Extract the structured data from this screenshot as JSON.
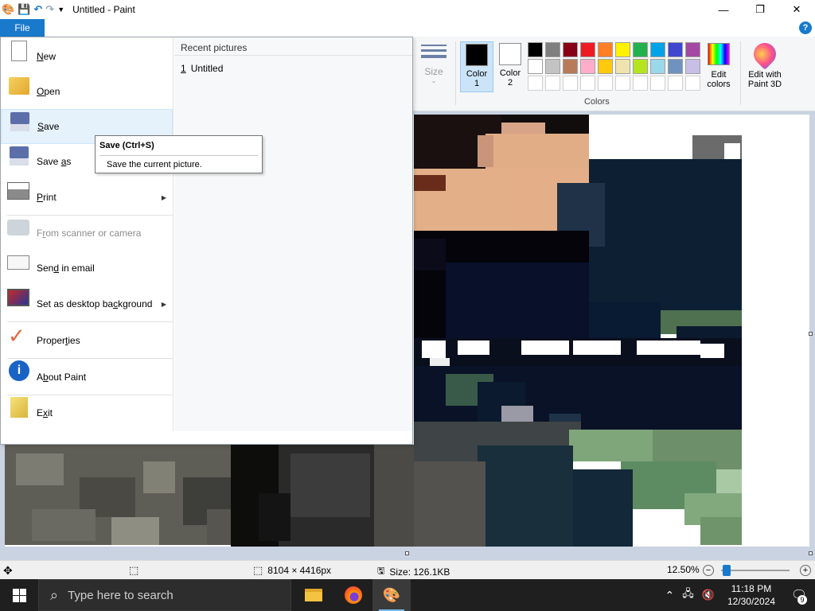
{
  "window": {
    "title": "Untitled - Paint",
    "controls": {
      "minimize": "—",
      "maximize": "❐",
      "close": "✕"
    }
  },
  "quick_access": {
    "icons": [
      "paint-app-icon",
      "save-icon",
      "undo-icon",
      "redo-icon",
      "customize-dropdown-icon"
    ]
  },
  "ribbon": {
    "file_tab_label": "File",
    "size_label": "Size",
    "color1_label": "Color\n1",
    "color1_value": "#000000",
    "color2_label": "Color\n2",
    "color2_value": "#ffffff",
    "colors_group_label": "Colors",
    "edit_colors_label": "Edit\ncolors",
    "edit_paint3d_label": "Edit with\nPaint 3D",
    "palette": [
      "#000000",
      "#7f7f7f",
      "#880015",
      "#ed1c24",
      "#ff7f27",
      "#fff200",
      "#22b14c",
      "#00a2e8",
      "#3f48cc",
      "#a349a4",
      "#ffffff",
      "#c3c3c3",
      "#b97a57",
      "#ffaec9",
      "#ffc90e",
      "#efe4b0",
      "#b5e61d",
      "#99d9ea",
      "#7092be",
      "#c8bfe7",
      "#ffffff",
      "#ffffff",
      "#ffffff",
      "#ffffff",
      "#ffffff",
      "#ffffff",
      "#ffffff",
      "#ffffff",
      "#ffffff",
      "#ffffff"
    ]
  },
  "file_menu": {
    "items": [
      {
        "label": "New",
        "icon": "new-file-icon",
        "mnemonic": 0
      },
      {
        "label": "Open",
        "icon": "open-folder-icon",
        "mnemonic": 0
      },
      {
        "label": "Save",
        "icon": "save-icon",
        "mnemonic": 0
      },
      {
        "label": "Save as",
        "icon": "save-as-icon",
        "mnemonic": 5
      },
      {
        "label": "Print",
        "icon": "printer-icon",
        "mnemonic": 0,
        "submenu": true
      },
      {
        "label": "From scanner or camera",
        "icon": "scanner-camera-icon",
        "mnemonic": 1,
        "disabled": true
      },
      {
        "label": "Send in email",
        "icon": "email-icon",
        "mnemonic": 3
      },
      {
        "label": "Set as desktop background",
        "icon": "desktop-background-icon",
        "mnemonic": 17,
        "submenu": true
      },
      {
        "label": "Properties",
        "icon": "checkmark-icon",
        "mnemonic": 6
      },
      {
        "label": "About Paint",
        "icon": "info-icon",
        "mnemonic": 1
      },
      {
        "label": "Exit",
        "icon": "exit-icon",
        "mnemonic": 1
      }
    ],
    "recent_title": "Recent pictures",
    "recent_items": [
      {
        "index": "1",
        "name": "Untitled"
      }
    ]
  },
  "tooltip": {
    "title": "Save (Ctrl+S)",
    "description": "Save the current picture."
  },
  "status_bar": {
    "dimensions": "8104 × 4416px",
    "size": "Size: 126.1KB",
    "zoom": "12.50%",
    "zoom_out": "−",
    "zoom_in": "+"
  },
  "taskbar": {
    "search_placeholder": "Type here to search",
    "time": "11:18 PM",
    "date": "12/30/2024",
    "notification_count": "9",
    "apps": [
      "file-explorer-icon",
      "firefox-icon",
      "paint-app-icon"
    ]
  },
  "canvas": {
    "pixels": [
      [
        520,
        144,
        110,
        70,
        "#1a1010"
      ],
      [
        630,
        144,
        120,
        30,
        "#120d0d"
      ],
      [
        630,
        154,
        55,
        15,
        "#d7a487"
      ],
      [
        610,
        168,
        130,
        60,
        "#e1ad86"
      ],
      [
        520,
        212,
        130,
        80,
        "#e3af88"
      ],
      [
        650,
        212,
        90,
        90,
        "#e3ae88"
      ],
      [
        520,
        220,
        40,
        20,
        "#6a2c1a"
      ],
      [
        600,
        170,
        20,
        40,
        "#c9957a"
      ],
      [
        740,
        144,
        130,
        60,
        "#ffffff"
      ],
      [
        870,
        170,
        62,
        50,
        "#6b6b6b"
      ],
      [
        910,
        180,
        20,
        30,
        "#ffffff"
      ],
      [
        740,
        200,
        192,
        190,
        "#0d1f33"
      ],
      [
        700,
        230,
        60,
        80,
        "#1f3247"
      ],
      [
        520,
        290,
        220,
        140,
        "#04040a"
      ],
      [
        520,
        300,
        40,
        40,
        "#0b0b1a"
      ],
      [
        560,
        330,
        180,
        100,
        "#08102a"
      ],
      [
        740,
        380,
        90,
        50,
        "#091a33"
      ],
      [
        830,
        390,
        102,
        30,
        "#4f7150"
      ],
      [
        850,
        410,
        82,
        20,
        "#0c1a30"
      ],
      [
        520,
        425,
        412,
        35,
        "#0a0f1e"
      ],
      [
        530,
        428,
        30,
        22,
        "#ffffff"
      ],
      [
        575,
        428,
        40,
        18,
        "#ffffff"
      ],
      [
        655,
        428,
        60,
        18,
        "#ffffff"
      ],
      [
        720,
        428,
        60,
        18,
        "#ffffff"
      ],
      [
        800,
        428,
        80,
        18,
        "#ffffff"
      ],
      [
        880,
        432,
        30,
        18,
        "#ffffff"
      ],
      [
        540,
        450,
        25,
        12,
        "#eeeeee"
      ],
      [
        520,
        460,
        412,
        80,
        "#0a1228"
      ],
      [
        560,
        470,
        60,
        40,
        "#395a48"
      ],
      [
        600,
        480,
        60,
        50,
        "#0b1a2e"
      ],
      [
        630,
        510,
        40,
        20,
        "#9a9aa6"
      ],
      [
        690,
        520,
        40,
        30,
        "#1e3347"
      ],
      [
        520,
        530,
        210,
        50,
        "#3f4446"
      ],
      [
        715,
        540,
        120,
        40,
        "#7fa67b"
      ],
      [
        820,
        540,
        112,
        100,
        "#6d8f6a"
      ],
      [
        780,
        580,
        120,
        60,
        "#5e8c62"
      ],
      [
        900,
        590,
        32,
        30,
        "#a9c8a4"
      ],
      [
        860,
        620,
        72,
        40,
        "#82a87e"
      ],
      [
        715,
        590,
        80,
        100,
        "#132838"
      ],
      [
        600,
        560,
        120,
        130,
        "#1a2f3c"
      ],
      [
        520,
        580,
        90,
        110,
        "#53524f"
      ],
      [
        880,
        650,
        52,
        35,
        "#6f946b"
      ],
      [
        6,
        559,
        310,
        126,
        "#5e5d56"
      ],
      [
        20,
        570,
        60,
        40,
        "#7d7c72"
      ],
      [
        100,
        600,
        70,
        50,
        "#4a4944"
      ],
      [
        180,
        580,
        40,
        40,
        "#828175"
      ],
      [
        230,
        600,
        60,
        60,
        "#3e3e3a"
      ],
      [
        40,
        640,
        80,
        40,
        "#6b6a62"
      ],
      [
        140,
        650,
        60,
        35,
        "#8f8e83"
      ],
      [
        260,
        640,
        50,
        45,
        "#56554f"
      ],
      [
        290,
        559,
        60,
        130,
        "#0d0d0c"
      ],
      [
        350,
        559,
        130,
        130,
        "#2a2a2a"
      ],
      [
        365,
        570,
        100,
        80,
        "#3c3c3c"
      ],
      [
        470,
        559,
        50,
        130,
        "#4b4a46"
      ],
      [
        325,
        620,
        40,
        60,
        "#141414"
      ]
    ]
  }
}
